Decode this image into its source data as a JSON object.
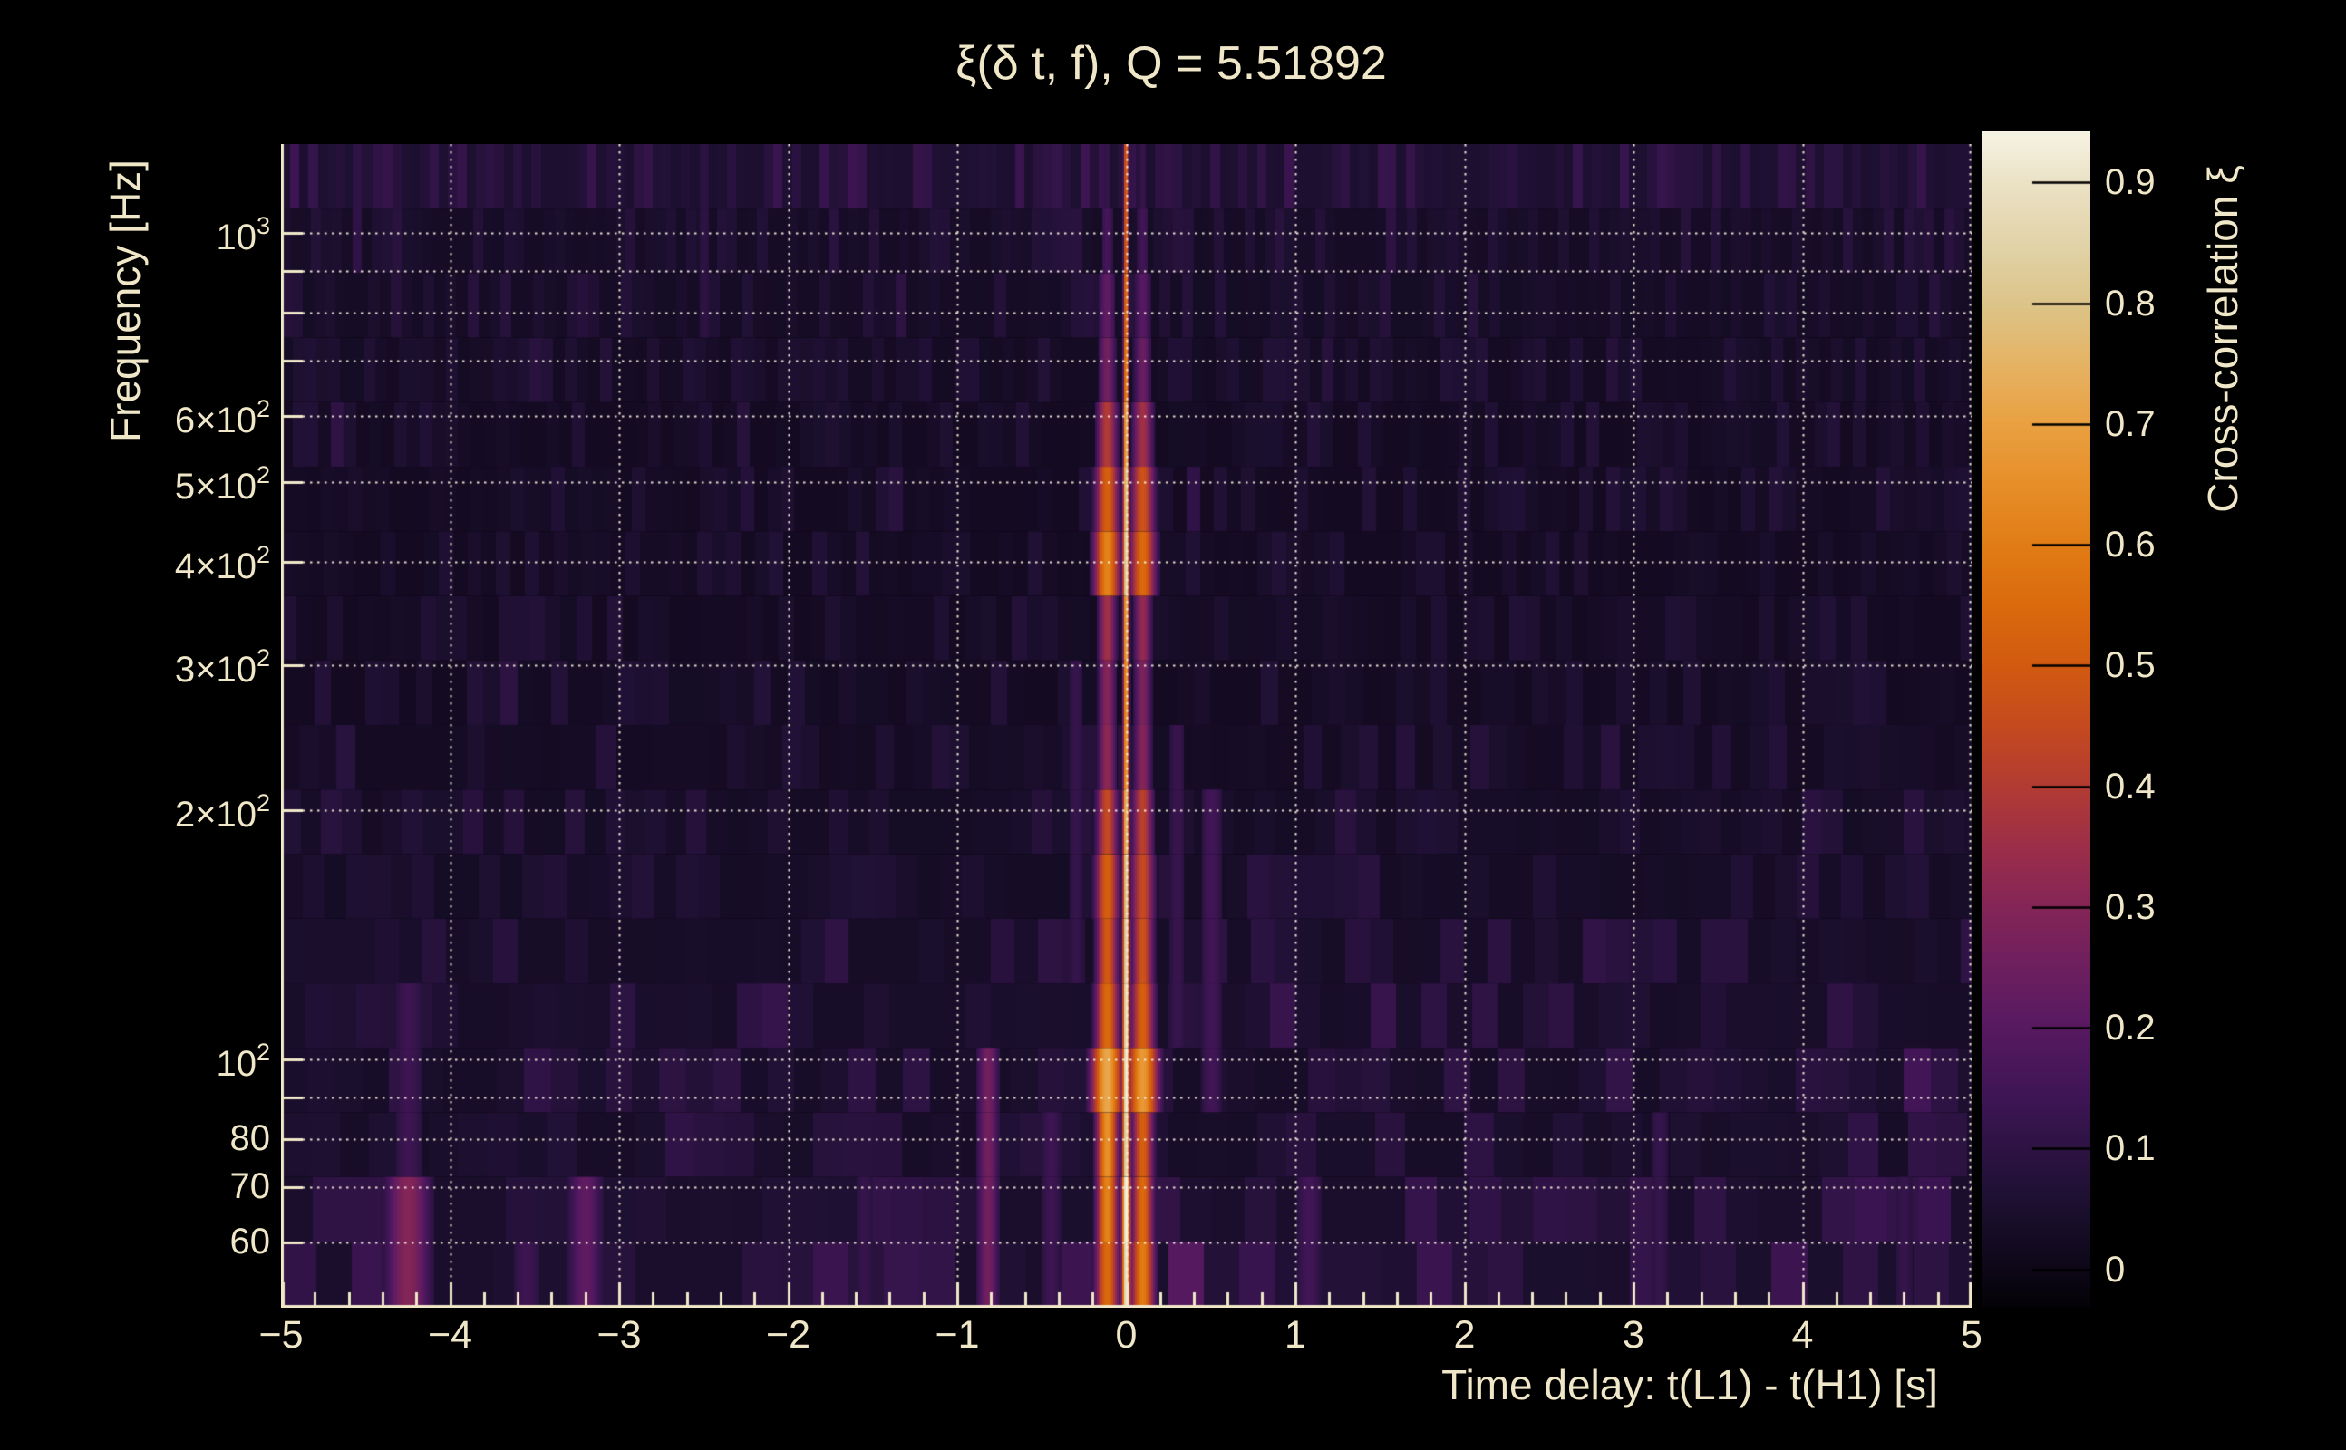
{
  "figure": {
    "background": "#000000",
    "text_color": "#f0e7c8",
    "axis_color": "#f0e7c8",
    "grid_color": "rgba(248,241,222,0.92)"
  },
  "chart_data": {
    "type": "heatmap",
    "title": "ξ(δ t, f), Q = 5.51892",
    "xlabel": "Time delay: t(L1) - t(H1) [s]",
    "ylabel": "Frequency [Hz]",
    "colorbar_label": "Cross-correlation ξ",
    "x_range": [
      -5,
      5
    ],
    "x_minor_step": 0.2,
    "x_major_ticks": [
      {
        "label": "−5",
        "t": -5
      },
      {
        "label": "−4",
        "t": -4
      },
      {
        "label": "−3",
        "t": -3
      },
      {
        "label": "−2",
        "t": -2
      },
      {
        "label": "−1",
        "t": -1
      },
      {
        "label": "0",
        "t": 0
      },
      {
        "label": "1",
        "t": 1
      },
      {
        "label": "2",
        "t": 2
      },
      {
        "label": "3",
        "t": 3
      },
      {
        "label": "4",
        "t": 4
      },
      {
        "label": "5",
        "t": 5
      }
    ],
    "x_grid_times": [
      -4,
      -3,
      -2,
      -1,
      0,
      1,
      2,
      3,
      4
    ],
    "y_scale": "log",
    "y_range_hz": [
      50.3,
      1281.3
    ],
    "y_ticks": [
      {
        "base": "10",
        "exp": "3",
        "f": 1000
      },
      {
        "base": "6×10",
        "exp": "2",
        "f": 600
      },
      {
        "base": "5×10",
        "exp": "2",
        "f": 500
      },
      {
        "base": "4×10",
        "exp": "2",
        "f": 400
      },
      {
        "base": "3×10",
        "exp": "2",
        "f": 300
      },
      {
        "base": "2×10",
        "exp": "2",
        "f": 200
      },
      {
        "base": "10",
        "exp": "2",
        "f": 100
      },
      {
        "base": "80",
        "exp": "",
        "f": 80
      },
      {
        "base": "70",
        "exp": "",
        "f": 70
      },
      {
        "base": "60",
        "exp": "",
        "f": 60
      }
    ],
    "y_grid_freqs": [
      1000,
      900,
      800,
      700,
      600,
      500,
      400,
      300,
      200,
      100,
      90,
      80,
      70,
      60
    ],
    "colorbar": {
      "vmin": -0.031,
      "vmax": 0.943,
      "ticks": [
        {
          "label": "0",
          "v": 0
        },
        {
          "label": "0.1",
          "v": 0.1
        },
        {
          "label": "0.2",
          "v": 0.2
        },
        {
          "label": "0.3",
          "v": 0.3
        },
        {
          "label": "0.4",
          "v": 0.4
        },
        {
          "label": "0.5",
          "v": 0.5
        },
        {
          "label": "0.6",
          "v": 0.6
        },
        {
          "label": "0.7",
          "v": 0.7
        },
        {
          "label": "0.8",
          "v": 0.8
        },
        {
          "label": "0.9",
          "v": 0.9
        }
      ]
    },
    "colormap_stops": [
      [
        -0.031,
        "#040207"
      ],
      [
        0.0,
        "#0d0717"
      ],
      [
        0.05,
        "#1b0f2e"
      ],
      [
        0.1,
        "#2d1343"
      ],
      [
        0.15,
        "#411556"
      ],
      [
        0.2,
        "#571961"
      ],
      [
        0.25,
        "#6d1f5f"
      ],
      [
        0.3,
        "#842557"
      ],
      [
        0.35,
        "#9c2e49"
      ],
      [
        0.4,
        "#b23b33"
      ],
      [
        0.45,
        "#c44a1f"
      ],
      [
        0.5,
        "#d15a10"
      ],
      [
        0.55,
        "#da6a0d"
      ],
      [
        0.6,
        "#e17c15"
      ],
      [
        0.65,
        "#e68e28"
      ],
      [
        0.7,
        "#e9a041"
      ],
      [
        0.75,
        "#e5b364"
      ],
      [
        0.8,
        "#dcc489"
      ],
      [
        0.85,
        "#e2d3a9"
      ],
      [
        0.9,
        "#ebe2c5"
      ],
      [
        0.943,
        "#f7f3e4"
      ]
    ],
    "peak": {
      "t0": -0.003,
      "wing_left_t": -0.115,
      "wing_right_t": 0.095,
      "halo_sigma": 0.16
    },
    "rows": [
      {
        "f0": 50.3,
        "f1": 60.2,
        "core": 0.93,
        "cw": 0.018,
        "wl": 0.55,
        "wr": 0.6,
        "ww": 0.05,
        "halo": 0.18,
        "nbase": 0.045,
        "namp": 0.1,
        "colw": 0.21
      },
      {
        "f0": 60.2,
        "f1": 72.1,
        "core": 0.97,
        "cw": 0.018,
        "wl": 0.62,
        "wr": 0.55,
        "ww": 0.045,
        "halo": 0.15,
        "nbase": 0.045,
        "namp": 0.09,
        "colw": 0.19
      },
      {
        "f0": 72.1,
        "f1": 86.3,
        "core": 0.9,
        "cw": 0.016,
        "wl": 0.66,
        "wr": 0.52,
        "ww": 0.045,
        "halo": 0.15,
        "nbase": 0.04,
        "namp": 0.08,
        "colw": 0.175
      },
      {
        "f0": 86.3,
        "f1": 103.3,
        "core": 0.95,
        "cw": 0.016,
        "wl": 0.72,
        "wr": 0.68,
        "ww": 0.065,
        "halo": 0.2,
        "nbase": 0.04,
        "namp": 0.08,
        "colw": 0.16
      },
      {
        "f0": 103.3,
        "f1": 123.6,
        "core": 0.93,
        "cw": 0.015,
        "wl": 0.55,
        "wr": 0.52,
        "ww": 0.05,
        "halo": 0.15,
        "nbase": 0.04,
        "namp": 0.08,
        "colw": 0.15
      },
      {
        "f0": 123.6,
        "f1": 148.0,
        "core": 0.9,
        "cw": 0.015,
        "wl": 0.5,
        "wr": 0.48,
        "ww": 0.045,
        "halo": 0.13,
        "nbase": 0.035,
        "namp": 0.07,
        "colw": 0.14
      },
      {
        "f0": 148.0,
        "f1": 177.2,
        "core": 0.87,
        "cw": 0.014,
        "wl": 0.52,
        "wr": 0.45,
        "ww": 0.05,
        "halo": 0.12,
        "nbase": 0.03,
        "namp": 0.065,
        "colw": 0.13
      },
      {
        "f0": 177.2,
        "f1": 212.1,
        "core": 0.8,
        "cw": 0.014,
        "wl": 0.45,
        "wr": 0.42,
        "ww": 0.045,
        "halo": 0.12,
        "nbase": 0.03,
        "namp": 0.06,
        "colw": 0.12
      },
      {
        "f0": 212.1,
        "f1": 253.9,
        "core": 0.72,
        "cw": 0.013,
        "wl": 0.32,
        "wr": 0.3,
        "ww": 0.04,
        "halo": 0.1,
        "nbase": 0.027,
        "namp": 0.055,
        "colw": 0.11
      },
      {
        "f0": 253.9,
        "f1": 303.9,
        "core": 0.7,
        "cw": 0.013,
        "wl": 0.3,
        "wr": 0.28,
        "ww": 0.04,
        "halo": 0.08,
        "nbase": 0.025,
        "namp": 0.05,
        "colw": 0.1
      },
      {
        "f0": 303.9,
        "f1": 363.8,
        "core": 0.75,
        "cw": 0.013,
        "wl": 0.36,
        "wr": 0.33,
        "ww": 0.04,
        "halo": 0.08,
        "nbase": 0.025,
        "namp": 0.05,
        "colw": 0.092
      },
      {
        "f0": 363.8,
        "f1": 435.5,
        "core": 0.9,
        "cw": 0.014,
        "wl": 0.62,
        "wr": 0.55,
        "ww": 0.055,
        "halo": 0.12,
        "nbase": 0.025,
        "namp": 0.05,
        "colw": 0.085
      },
      {
        "f0": 435.5,
        "f1": 521.3,
        "core": 0.85,
        "cw": 0.013,
        "wl": 0.52,
        "wr": 0.48,
        "ww": 0.05,
        "halo": 0.1,
        "nbase": 0.025,
        "namp": 0.05,
        "colw": 0.08
      },
      {
        "f0": 521.3,
        "f1": 624.1,
        "core": 0.78,
        "cw": 0.012,
        "wl": 0.4,
        "wr": 0.36,
        "ww": 0.045,
        "halo": 0.08,
        "nbase": 0.025,
        "namp": 0.05,
        "colw": 0.075
      },
      {
        "f0": 624.1,
        "f1": 747.0,
        "core": 0.65,
        "cw": 0.012,
        "wl": 0.26,
        "wr": 0.24,
        "ww": 0.04,
        "halo": 0.06,
        "nbase": 0.028,
        "namp": 0.05,
        "colw": 0.07
      },
      {
        "f0": 747.0,
        "f1": 894.2,
        "core": 0.6,
        "cw": 0.012,
        "wl": 0.22,
        "wr": 0.2,
        "ww": 0.04,
        "halo": 0.06,
        "nbase": 0.03,
        "namp": 0.055,
        "colw": 0.065
      },
      {
        "f0": 894.2,
        "f1": 1070.4,
        "core": 0.55,
        "cw": 0.011,
        "wl": 0.16,
        "wr": 0.15,
        "ww": 0.035,
        "halo": 0.05,
        "nbase": 0.033,
        "namp": 0.06,
        "colw": 0.06
      },
      {
        "f0": 1070.4,
        "f1": 1281.3,
        "core": 0.55,
        "cw": 0.011,
        "wl": 0.12,
        "wr": 0.12,
        "ww": 0.03,
        "halo": 0.05,
        "nbase": 0.055,
        "namp": 0.085,
        "colw": 0.055
      }
    ],
    "streaks": [
      {
        "t": -4.25,
        "r0": 0,
        "r1": 1,
        "amp": 0.3,
        "w": 0.1
      },
      {
        "t": -4.25,
        "r0": 2,
        "r1": 4,
        "amp": 0.14,
        "w": 0.08
      },
      {
        "t": -3.2,
        "r0": 0,
        "r1": 1,
        "amp": 0.22,
        "w": 0.08
      },
      {
        "t": -3.55,
        "r0": 0,
        "r1": 0,
        "amp": 0.14,
        "w": 0.08
      },
      {
        "t": -0.82,
        "r0": 0,
        "r1": 3,
        "amp": 0.26,
        "w": 0.05
      },
      {
        "t": -0.45,
        "r0": 0,
        "r1": 2,
        "amp": 0.14,
        "w": 0.06
      },
      {
        "t": 0.5,
        "r0": 3,
        "r1": 7,
        "amp": 0.15,
        "w": 0.06
      },
      {
        "t": 0.3,
        "r0": 4,
        "r1": 8,
        "amp": 0.13,
        "w": 0.05
      },
      {
        "t": -0.3,
        "r0": 5,
        "r1": 9,
        "amp": 0.12,
        "w": 0.05
      },
      {
        "t": 1.08,
        "r0": 0,
        "r1": 1,
        "amp": 0.15,
        "w": 0.07
      },
      {
        "t": 3.15,
        "r0": 0,
        "r1": 2,
        "amp": 0.12,
        "w": 0.06
      },
      {
        "t": -1.55,
        "r0": 0,
        "r1": 1,
        "amp": 0.12,
        "w": 0.06
      },
      {
        "t": 4.6,
        "r0": 0,
        "r1": 1,
        "amp": 0.12,
        "w": 0.06
      },
      {
        "t": -2.5,
        "r0": 15,
        "r1": 17,
        "amp": 0.1,
        "w": 0.05
      },
      {
        "t": -4.55,
        "r0": 16,
        "r1": 17,
        "amp": 0.11,
        "w": 0.05
      }
    ],
    "noise_seed": 20250901
  }
}
